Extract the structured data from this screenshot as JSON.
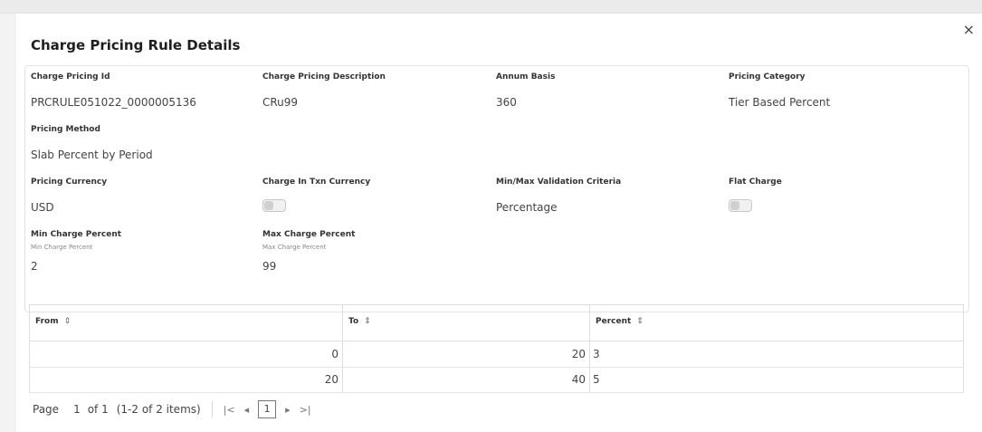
{
  "modal": {
    "title": "Charge Pricing Rule Details",
    "close_symbol": "×"
  },
  "fields": {
    "charge_pricing_id": {
      "label": "Charge Pricing Id",
      "value": "PRCRULE051022_0000005136"
    },
    "charge_pricing_description": {
      "label": "Charge Pricing Description",
      "value": "CRu99"
    },
    "annum_basis": {
      "label": "Annum Basis",
      "value": "360"
    },
    "pricing_category": {
      "label": "Pricing Category",
      "value": "Tier Based Percent"
    },
    "pricing_method": {
      "label": "Pricing Method",
      "value": "Slab Percent by Period"
    },
    "pricing_currency": {
      "label": "Pricing Currency",
      "value": "USD"
    },
    "charge_in_txn_currency": {
      "label": "Charge In Txn Currency",
      "toggle_on": false
    },
    "min_max_validation_criteria": {
      "label": "Min/Max Validation Criteria",
      "value": "Percentage"
    },
    "flat_charge": {
      "label": "Flat Charge",
      "toggle_on": false
    },
    "min_charge_percent": {
      "label": "Min Charge Percent",
      "sublabel": "Min Charge Percent",
      "value": "2"
    },
    "max_charge_percent": {
      "label": "Max Charge Percent",
      "sublabel": "Max Charge Percent",
      "value": "99"
    }
  },
  "table": {
    "columns": [
      "From",
      "To",
      "Percent"
    ],
    "sort_icon": "⇕",
    "rows": [
      {
        "from": "0",
        "to": "20",
        "percent": "3"
      },
      {
        "from": "20",
        "to": "40",
        "percent": "5"
      }
    ]
  },
  "pagination": {
    "page_label": "Page",
    "page": "1",
    "of_label": "of 1",
    "items_label": "(1-2 of 2 items)",
    "first_icon": "|<",
    "prev_icon": "◂",
    "current_page": "1",
    "next_icon": "▸",
    "last_icon": ">|"
  }
}
